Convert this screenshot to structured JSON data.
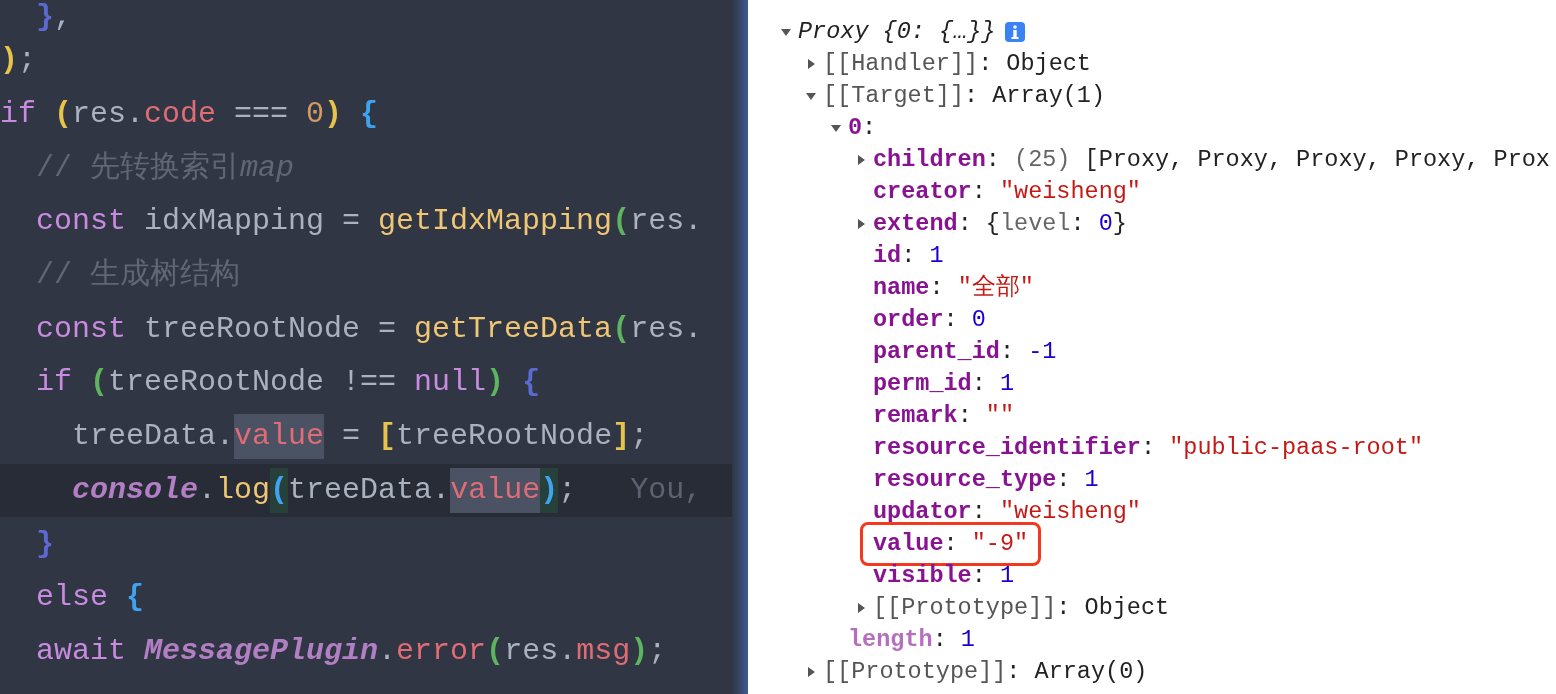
{
  "editor": {
    "lines": [
      {
        "current": false,
        "tokens": [
          {
            "text": "  }",
            "kind": "bracket",
            "color": "#5a6ad0",
            "highlight": false
          },
          {
            "text": ",",
            "kind": "plain",
            "highlight": false
          }
        ]
      },
      {
        "current": false,
        "tokens": [
          {
            "text": ")",
            "kind": "bracket",
            "color": "#e6c34a",
            "highlight": false
          },
          {
            "text": ";",
            "kind": "plain",
            "highlight": false
          }
        ]
      },
      {
        "current": false,
        "tokens": [
          {
            "text": "if",
            "kind": "keyword",
            "highlight": false
          },
          {
            "text": " (",
            "kind": "bracket",
            "color": "#e6c34a",
            "highlight": false
          },
          {
            "text": "res.",
            "kind": "plain",
            "highlight": false
          },
          {
            "text": "code",
            "kind": "property",
            "highlight": false
          },
          {
            "text": " === ",
            "kind": "plain",
            "highlight": false
          },
          {
            "text": "0",
            "kind": "number",
            "highlight": false
          },
          {
            "text": ")",
            "kind": "bracket",
            "color": "#e6c34a",
            "highlight": false
          },
          {
            "text": " {",
            "kind": "bracket",
            "color": "#3fa3f0",
            "highlight": false
          }
        ]
      },
      {
        "current": false,
        "tokens": [
          {
            "text": "  // 先转换索引",
            "kind": "comment",
            "highlight": false
          },
          {
            "text": "map",
            "kind": "comment_italic",
            "highlight": false
          }
        ]
      },
      {
        "current": false,
        "tokens": [
          {
            "text": "  const",
            "kind": "keyword",
            "highlight": false
          },
          {
            "text": " idxMapping = ",
            "kind": "plain",
            "highlight": false
          },
          {
            "text": "getIdxMapping",
            "kind": "function",
            "highlight": false
          },
          {
            "text": "(",
            "kind": "bracket",
            "color": "#5fb55f",
            "highlight": false
          },
          {
            "text": "res.",
            "kind": "plain",
            "highlight": false
          }
        ]
      },
      {
        "current": false,
        "tokens": [
          {
            "text": "  // 生成树结构",
            "kind": "comment",
            "highlight": false
          }
        ]
      },
      {
        "current": false,
        "tokens": [
          {
            "text": "  const",
            "kind": "keyword",
            "highlight": false
          },
          {
            "text": " treeRootNode = ",
            "kind": "plain",
            "highlight": false
          },
          {
            "text": "getTreeData",
            "kind": "function",
            "highlight": false
          },
          {
            "text": "(",
            "kind": "bracket",
            "color": "#5fb55f",
            "highlight": false
          },
          {
            "text": "res.",
            "kind": "plain",
            "highlight": false
          }
        ]
      },
      {
        "current": false,
        "tokens": [
          {
            "text": "  if",
            "kind": "keyword",
            "highlight": false
          },
          {
            "text": " (",
            "kind": "bracket",
            "color": "#5fb55f",
            "highlight": false
          },
          {
            "text": "treeRootNode !== ",
            "kind": "plain",
            "highlight": false
          },
          {
            "text": "null",
            "kind": "keyword",
            "highlight": false
          },
          {
            "text": ")",
            "kind": "bracket",
            "color": "#5fb55f",
            "highlight": false
          },
          {
            "text": " {",
            "kind": "bracket",
            "color": "#5a6ad0",
            "highlight": false
          }
        ]
      },
      {
        "current": false,
        "tokens": [
          {
            "text": "    treeData.",
            "kind": "plain",
            "highlight": false
          },
          {
            "text": "value",
            "kind": "property",
            "highlight": true
          },
          {
            "text": " = ",
            "kind": "plain",
            "highlight": false
          },
          {
            "text": "[",
            "kind": "bracket",
            "color": "#e6c34a",
            "highlight": false
          },
          {
            "text": "treeRootNode",
            "kind": "plain",
            "highlight": false
          },
          {
            "text": "]",
            "kind": "bracket",
            "color": "#e6c34a",
            "highlight": false
          },
          {
            "text": ";",
            "kind": "plain",
            "highlight": false
          }
        ]
      },
      {
        "current": true,
        "tokens": [
          {
            "text": "    console",
            "kind": "object",
            "highlight": false
          },
          {
            "text": ".",
            "kind": "plain",
            "highlight": false
          },
          {
            "text": "log",
            "kind": "function",
            "highlight": false
          },
          {
            "text": "(",
            "kind": "match",
            "color": "#3fa3f0",
            "highlight": true
          },
          {
            "text": "treeData.",
            "kind": "plain",
            "highlight": false
          },
          {
            "text": "value",
            "kind": "property",
            "highlight": true
          },
          {
            "text": ")",
            "kind": "match",
            "color": "#3fa3f0",
            "highlight": true
          },
          {
            "text": ";",
            "kind": "plain",
            "highlight": false
          },
          {
            "text": "   You,",
            "kind": "ghost",
            "highlight": false
          }
        ]
      },
      {
        "current": false,
        "tokens": [
          {
            "text": "  }",
            "kind": "bracket",
            "color": "#5a6ad0",
            "highlight": false
          }
        ]
      },
      {
        "current": false,
        "tokens": [
          {
            "text": "  else",
            "kind": "keyword",
            "highlight": false
          },
          {
            "text": " {",
            "kind": "bracket",
            "color": "#3fa3f0",
            "highlight": false
          }
        ]
      },
      {
        "current": false,
        "tokens": [
          {
            "text": "  await ",
            "kind": "keyword",
            "highlight": false
          },
          {
            "text": "MessagePlugin",
            "kind": "object",
            "highlight": false
          },
          {
            "text": ".",
            "kind": "plain",
            "highlight": false
          },
          {
            "text": "error",
            "kind": "property",
            "highlight": false
          },
          {
            "text": "(",
            "kind": "bracket",
            "color": "#5fb55f",
            "highlight": false
          },
          {
            "text": "res.",
            "kind": "plain",
            "highlight": false
          },
          {
            "text": "msg",
            "kind": "property",
            "highlight": false
          },
          {
            "text": ")",
            "kind": "bracket",
            "color": "#5fb55f",
            "highlight": false
          },
          {
            "text": ";",
            "kind": "plain",
            "highlight": false
          }
        ]
      }
    ]
  },
  "console": {
    "tree": [
      {
        "kind": "group",
        "expanded": true,
        "info": true,
        "boxed": false,
        "segments": [
          {
            "text": "Proxy {0: {…}}",
            "kind": "summary"
          }
        ],
        "children": [
          {
            "kind": "group",
            "expanded": false,
            "info": false,
            "boxed": false,
            "segments": [
              {
                "text": "[[Handler]]",
                "kind": "internal"
              },
              {
                "text": ": Object",
                "kind": "plain"
              }
            ]
          },
          {
            "kind": "group",
            "expanded": true,
            "info": false,
            "boxed": false,
            "segments": [
              {
                "text": "[[Target]]",
                "kind": "internal"
              },
              {
                "text": ": Array(1)",
                "kind": "plain"
              }
            ],
            "children": [
              {
                "kind": "group",
                "expanded": true,
                "info": false,
                "boxed": false,
                "segments": [
                  {
                    "text": "0",
                    "kind": "key"
                  },
                  {
                    "text": ":",
                    "kind": "plain"
                  }
                ],
                "children": [
                  {
                    "kind": "group",
                    "expanded": false,
                    "info": false,
                    "boxed": false,
                    "segments": [
                      {
                        "text": "children",
                        "kind": "key"
                      },
                      {
                        "text": ": ",
                        "kind": "plain"
                      },
                      {
                        "text": "(25) ",
                        "kind": "count"
                      },
                      {
                        "text": "[Proxy, Proxy, Proxy, Proxy, Prox",
                        "kind": "plain"
                      }
                    ]
                  },
                  {
                    "kind": "leaf",
                    "info": false,
                    "boxed": false,
                    "segments": [
                      {
                        "text": "creator",
                        "kind": "key"
                      },
                      {
                        "text": ": ",
                        "kind": "plain"
                      },
                      {
                        "text": "\"weisheng\"",
                        "kind": "string"
                      }
                    ]
                  },
                  {
                    "kind": "group",
                    "expanded": false,
                    "info": false,
                    "boxed": false,
                    "segments": [
                      {
                        "text": "extend",
                        "kind": "key"
                      },
                      {
                        "text": ": {",
                        "kind": "plain"
                      },
                      {
                        "text": "level",
                        "kind": "count"
                      },
                      {
                        "text": ": ",
                        "kind": "plain"
                      },
                      {
                        "text": "0",
                        "kind": "number"
                      },
                      {
                        "text": "}",
                        "kind": "plain"
                      }
                    ]
                  },
                  {
                    "kind": "leaf",
                    "info": false,
                    "boxed": false,
                    "segments": [
                      {
                        "text": "id",
                        "kind": "key"
                      },
                      {
                        "text": ": ",
                        "kind": "plain"
                      },
                      {
                        "text": "1",
                        "kind": "number"
                      }
                    ]
                  },
                  {
                    "kind": "leaf",
                    "info": false,
                    "boxed": false,
                    "segments": [
                      {
                        "text": "name",
                        "kind": "key"
                      },
                      {
                        "text": ": ",
                        "kind": "plain"
                      },
                      {
                        "text": "\"全部\"",
                        "kind": "string"
                      }
                    ]
                  },
                  {
                    "kind": "leaf",
                    "info": false,
                    "boxed": false,
                    "segments": [
                      {
                        "text": "order",
                        "kind": "key"
                      },
                      {
                        "text": ": ",
                        "kind": "plain"
                      },
                      {
                        "text": "0",
                        "kind": "number"
                      }
                    ]
                  },
                  {
                    "kind": "leaf",
                    "info": false,
                    "boxed": false,
                    "segments": [
                      {
                        "text": "parent_id",
                        "kind": "key"
                      },
                      {
                        "text": ": ",
                        "kind": "plain"
                      },
                      {
                        "text": "-1",
                        "kind": "number"
                      }
                    ]
                  },
                  {
                    "kind": "leaf",
                    "info": false,
                    "boxed": false,
                    "segments": [
                      {
                        "text": "perm_id",
                        "kind": "key"
                      },
                      {
                        "text": ": ",
                        "kind": "plain"
                      },
                      {
                        "text": "1",
                        "kind": "number"
                      }
                    ]
                  },
                  {
                    "kind": "leaf",
                    "info": false,
                    "boxed": false,
                    "segments": [
                      {
                        "text": "remark",
                        "kind": "key"
                      },
                      {
                        "text": ": ",
                        "kind": "plain"
                      },
                      {
                        "text": "\"\"",
                        "kind": "string"
                      }
                    ]
                  },
                  {
                    "kind": "leaf",
                    "info": false,
                    "boxed": false,
                    "segments": [
                      {
                        "text": "resource_identifier",
                        "kind": "key"
                      },
                      {
                        "text": ": ",
                        "kind": "plain"
                      },
                      {
                        "text": "\"public-paas-root\"",
                        "kind": "string"
                      }
                    ]
                  },
                  {
                    "kind": "leaf",
                    "info": false,
                    "boxed": false,
                    "segments": [
                      {
                        "text": "resource_type",
                        "kind": "key"
                      },
                      {
                        "text": ": ",
                        "kind": "plain"
                      },
                      {
                        "text": "1",
                        "kind": "number"
                      }
                    ]
                  },
                  {
                    "kind": "leaf",
                    "info": false,
                    "boxed": false,
                    "segments": [
                      {
                        "text": "updator",
                        "kind": "key"
                      },
                      {
                        "text": ": ",
                        "kind": "plain"
                      },
                      {
                        "text": "\"weisheng\"",
                        "kind": "string"
                      }
                    ]
                  },
                  {
                    "kind": "leaf",
                    "info": false,
                    "boxed": true,
                    "segments": [
                      {
                        "text": "value",
                        "kind": "key"
                      },
                      {
                        "text": ": ",
                        "kind": "plain"
                      },
                      {
                        "text": "\"-9\"",
                        "kind": "string"
                      }
                    ]
                  },
                  {
                    "kind": "leaf",
                    "info": false,
                    "boxed": false,
                    "segments": [
                      {
                        "text": "visible",
                        "kind": "key"
                      },
                      {
                        "text": ": ",
                        "kind": "plain"
                      },
                      {
                        "text": "1",
                        "kind": "number"
                      }
                    ]
                  },
                  {
                    "kind": "group",
                    "expanded": false,
                    "info": false,
                    "boxed": false,
                    "segments": [
                      {
                        "text": "[[Prototype]]",
                        "kind": "internal"
                      },
                      {
                        "text": ": Object",
                        "kind": "plain"
                      }
                    ]
                  }
                ]
              },
              {
                "kind": "leaf",
                "info": false,
                "boxed": false,
                "segments": [
                  {
                    "text": "length",
                    "kind": "nonenum"
                  },
                  {
                    "text": ": ",
                    "kind": "plain"
                  },
                  {
                    "text": "1",
                    "kind": "number"
                  }
                ]
              }
            ]
          },
          {
            "kind": "group",
            "expanded": false,
            "info": false,
            "boxed": false,
            "segments": [
              {
                "text": "[[Prototype]]",
                "kind": "internal"
              },
              {
                "text": ": Array(0)",
                "kind": "plain"
              }
            ]
          }
        ]
      }
    ]
  }
}
